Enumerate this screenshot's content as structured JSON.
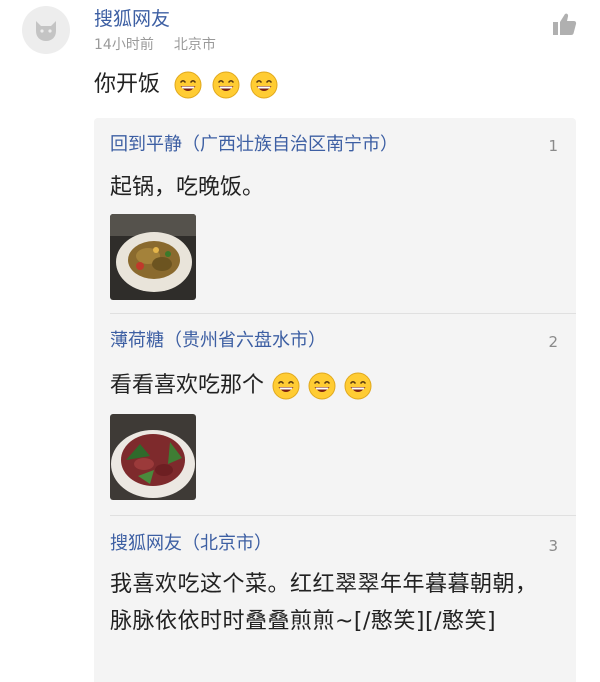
{
  "comment": {
    "username": "搜狐网友",
    "time": "14小时前",
    "location": "北京市",
    "text": "你开饭",
    "emoji": "grinning-face-emoji",
    "emoji_count": 3
  },
  "replies": [
    {
      "author": "回到平静（广西壮族自治区南宁市）",
      "index": "1",
      "text": "起锅，吃晚饭。",
      "image": "dish-photo-stirfry",
      "emoji_count": 0
    },
    {
      "author": "薄荷糖（贵州省六盘水市）",
      "index": "2",
      "text": "看看喜欢吃那个",
      "image": "dish-photo-sliced-meat",
      "emoji_count": 3
    },
    {
      "author": "搜狐网友（北京市）",
      "index": "3",
      "text": "我喜欢吃这个菜。红红翠翠年年暮暮朝朝，脉脉依依时时叠叠煎煎~[/憨笑][/憨笑]",
      "emoji_count": 0
    }
  ],
  "colors": {
    "link": "#3d5fa3",
    "text": "#222222",
    "meta": "#9a9a9a",
    "reply_bg": "#f4f4f4",
    "emoji_face": "#ffcc33"
  },
  "icons": [
    "user-avatar-icon",
    "thumbs-up-icon",
    "grinning-face-emoji"
  ]
}
